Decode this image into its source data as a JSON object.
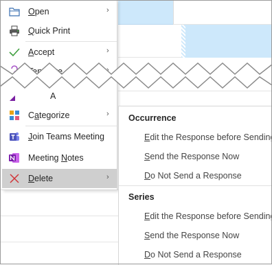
{
  "menu": {
    "items": [
      {
        "label": "Open",
        "underline_index": 0,
        "has_submenu": true,
        "icon": "folder-icon"
      },
      {
        "label": "Quick Print",
        "underline_index": 0,
        "has_submenu": false,
        "icon": "printer-icon"
      },
      {
        "label": "Accept",
        "underline_index": 0,
        "has_submenu": true,
        "icon": "checkmark-icon"
      },
      {
        "label": "Tentative",
        "underline_index": 0,
        "has_submenu": true,
        "icon": "question-icon"
      },
      {
        "label": "Categorize",
        "underline_index": 1,
        "has_submenu": true,
        "icon": "categorize-icon"
      },
      {
        "label": "Join Teams Meeting",
        "underline_index": 0,
        "has_submenu": false,
        "icon": "teams-icon"
      },
      {
        "label": "Meeting Notes",
        "underline_index": 8,
        "has_submenu": false,
        "icon": "onenote-icon"
      },
      {
        "label": "Delete",
        "underline_index": 0,
        "has_submenu": true,
        "icon": "delete-x-icon",
        "highlighted": true
      }
    ],
    "torn_fragment": "A"
  },
  "submenu": {
    "sections": [
      {
        "header": "Occurrence",
        "items": [
          {
            "label": "Edit the Response before Sending",
            "underline_index": 0
          },
          {
            "label": "Send the Response Now",
            "underline_index": 0
          },
          {
            "label": "Do Not Send a Response",
            "underline_index": 0
          }
        ]
      },
      {
        "header": "Series",
        "items": [
          {
            "label": "Edit the Response before Sending",
            "underline_index": 0
          },
          {
            "label": "Send the Response Now",
            "underline_index": 0
          },
          {
            "label": "Do Not Send a Response",
            "underline_index": 0
          }
        ]
      }
    ]
  },
  "colors": {
    "calendar_selected": "#cde8fb",
    "highlight": "#cfcfcf",
    "accept_green": "#3f9f3f",
    "tentative_purple": "#a855c8",
    "delete_red": "#d13438",
    "teams_purple": "#4b53bc",
    "onenote_purple": "#7719aa"
  }
}
